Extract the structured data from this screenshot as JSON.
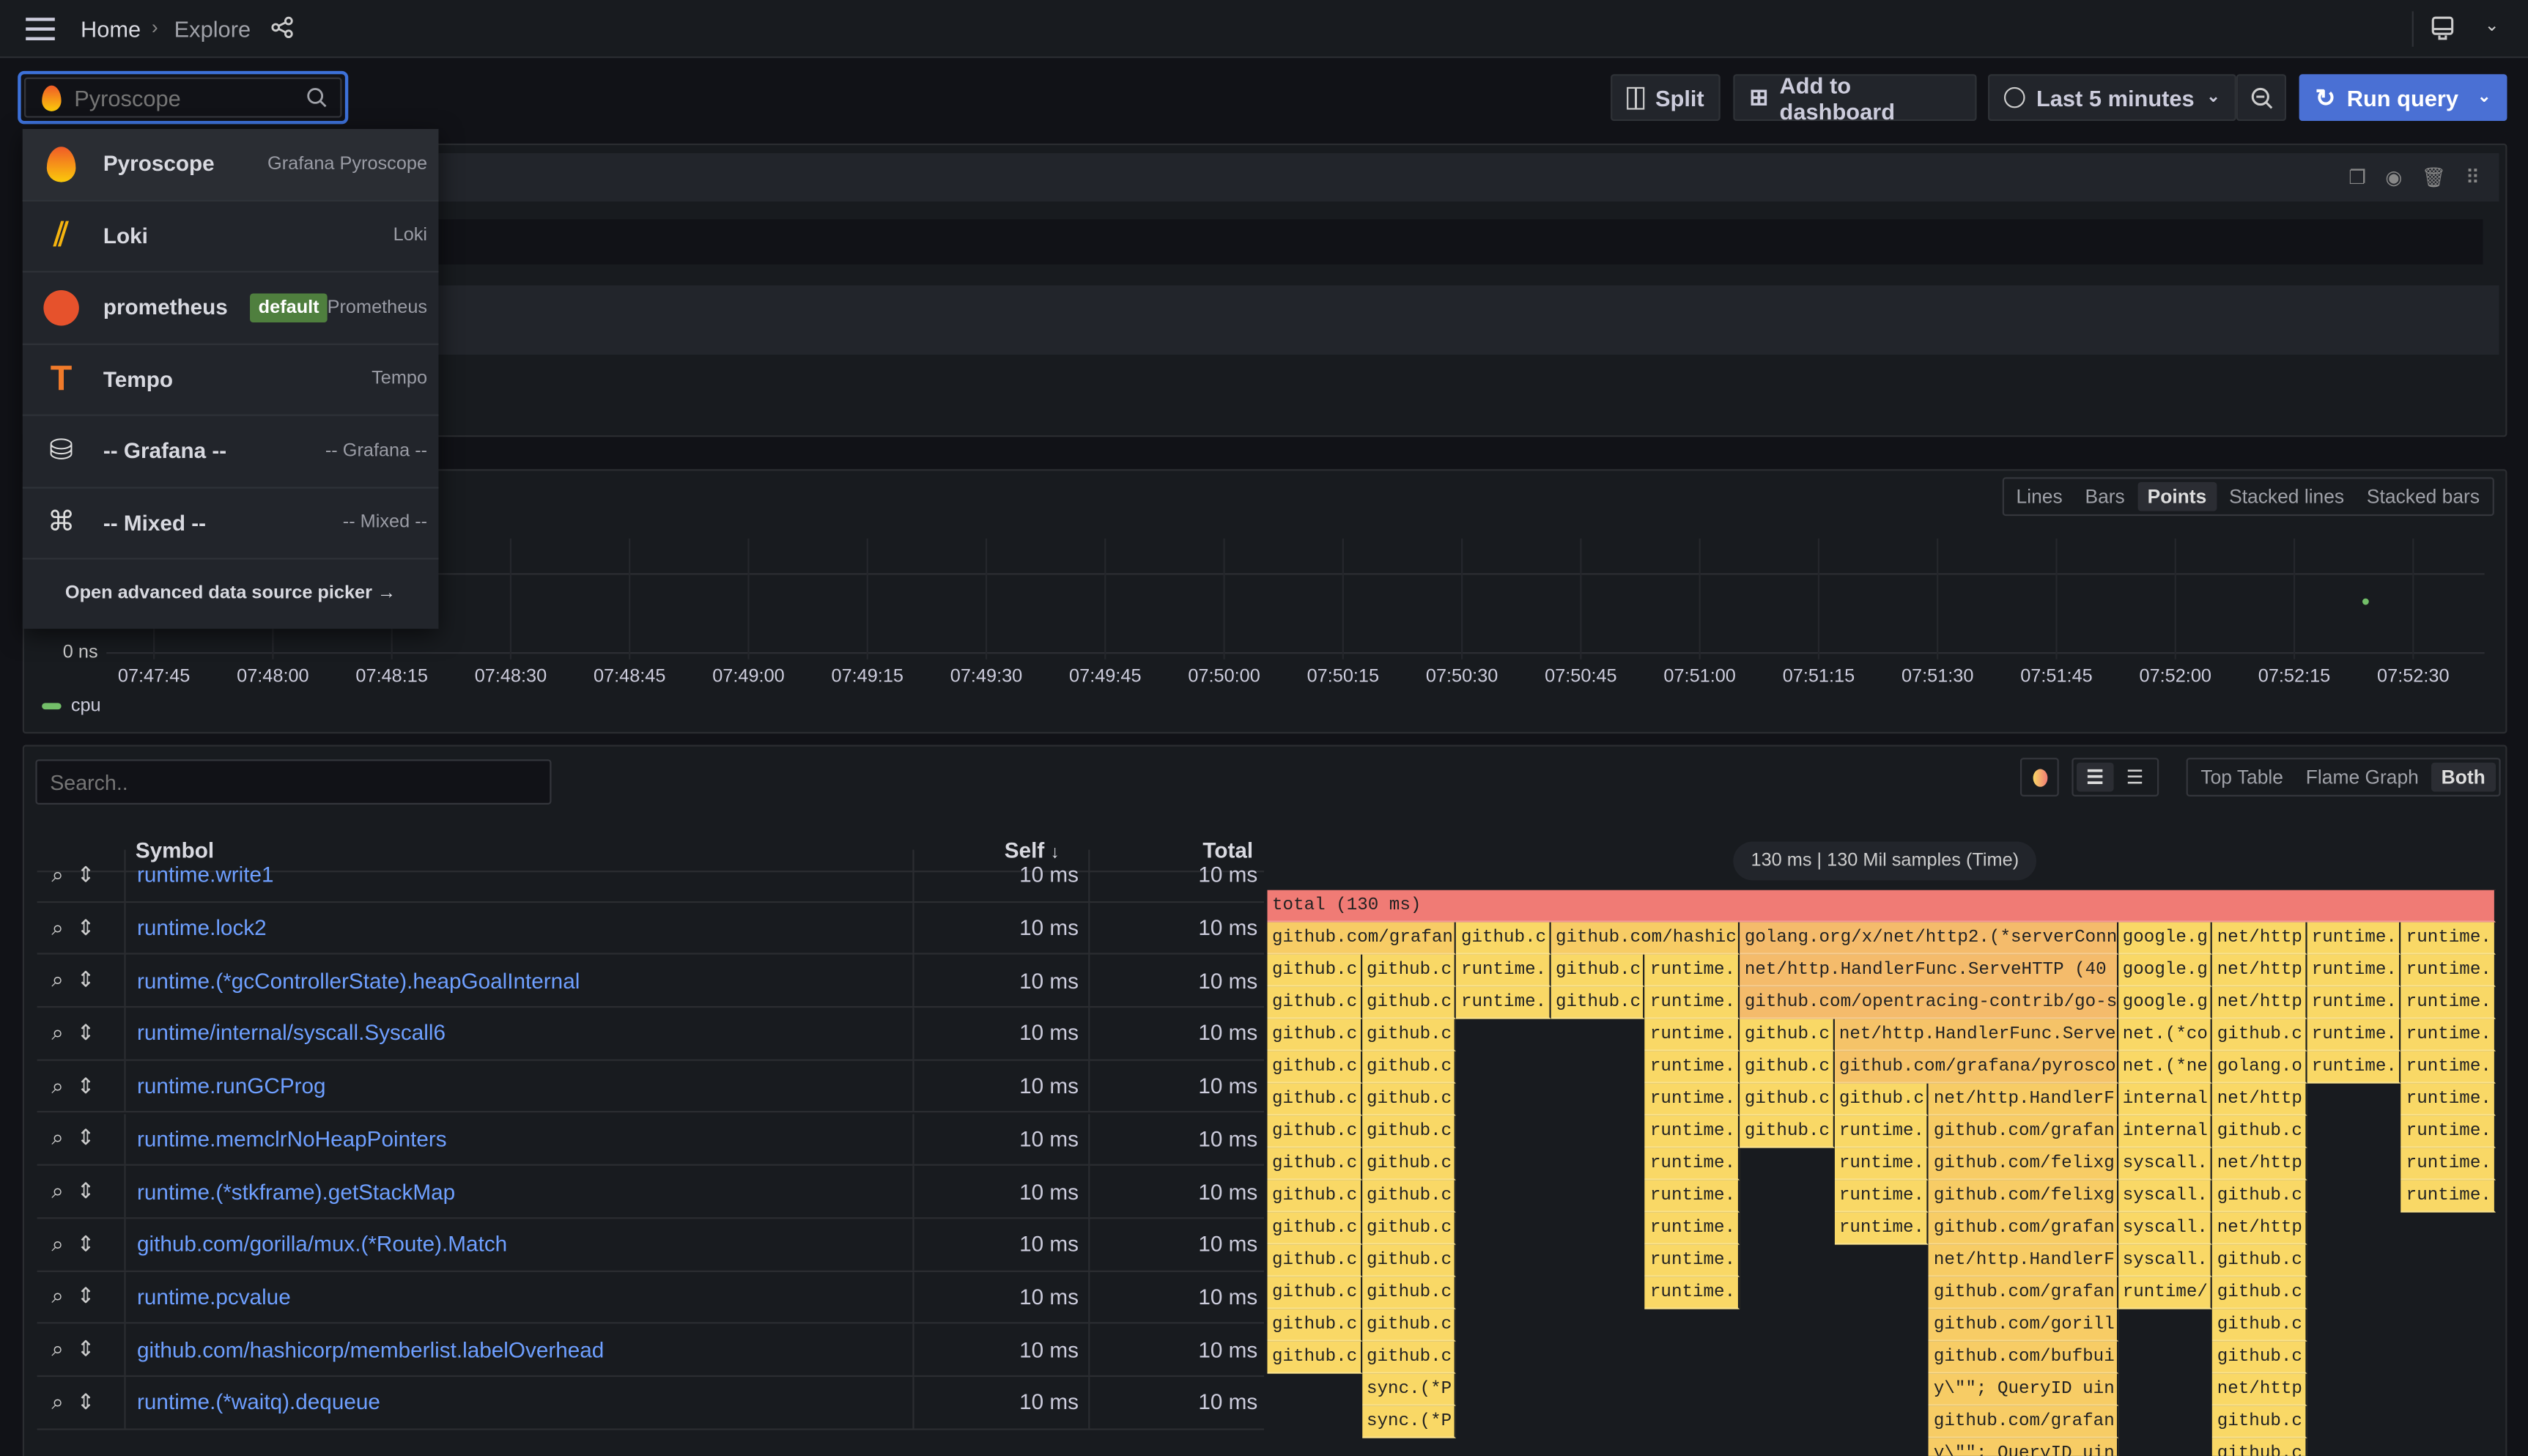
{
  "topbar": {
    "breadcrumb": [
      "Home",
      "Explore"
    ]
  },
  "toolbar": {
    "datasource_input": "Pyroscope",
    "split": "Split",
    "add_to_dashboard": "Add to dashboard",
    "time_range": "Last 5 minutes",
    "run_query": "Run query",
    "accent": "#3d71d9"
  },
  "datasource_dropdown": {
    "items": [
      {
        "name": "Pyroscope",
        "type": "Grafana Pyroscope",
        "icon": "pyroscope-icon"
      },
      {
        "name": "Loki",
        "type": "Loki",
        "icon": "loki-icon"
      },
      {
        "name": "prometheus",
        "type": "Prometheus",
        "badge": "default",
        "icon": "prometheus-icon"
      },
      {
        "name": "Tempo",
        "type": "Tempo",
        "icon": "tempo-icon"
      },
      {
        "name": "-- Grafana --",
        "type": "-- Grafana --",
        "icon": "grafana-db-icon"
      },
      {
        "name": "-- Mixed --",
        "type": "-- Mixed --",
        "icon": "mixed-icon"
      }
    ],
    "advanced_link": "Open advanced data source picker →"
  },
  "graph": {
    "modes": [
      "Lines",
      "Bars",
      "Points",
      "Stacked lines",
      "Stacked bars"
    ],
    "active_mode": "Points"
  },
  "chart_data": {
    "type": "scatter",
    "x_ticks": [
      "07:47:45",
      "07:48:00",
      "07:48:15",
      "07:48:30",
      "07:48:45",
      "07:49:00",
      "07:49:15",
      "07:49:30",
      "07:49:45",
      "07:50:00",
      "07:50:15",
      "07:50:30",
      "07:50:45",
      "07:51:00",
      "07:51:15",
      "07:51:30",
      "07:51:45",
      "07:52:00",
      "07:52:15",
      "07:52:30"
    ],
    "xlim": [
      "07:47:39",
      "07:52:39"
    ],
    "y_tick_labels": [
      "0 ns"
    ],
    "series": [
      {
        "name": "cpu",
        "color": "#73bf69",
        "points": [
          {
            "x": "07:52:24",
            "y_ms": 130
          }
        ]
      }
    ],
    "ylim_ms": [
      0,
      200
    ],
    "grid": true,
    "legend": "bottom-left"
  },
  "flame": {
    "search_placeholder": "Search..",
    "views": [
      "Top Table",
      "Flame Graph",
      "Both"
    ],
    "active_view": "Both",
    "table": {
      "headers": [
        "Symbol",
        "Self",
        "Total"
      ],
      "sort_indicator": "↓",
      "rows": [
        [
          "runtime.write1",
          "10 ms",
          "10 ms"
        ],
        [
          "runtime.lock2",
          "10 ms",
          "10 ms"
        ],
        [
          "runtime.(*gcControllerState).heapGoalInternal",
          "10 ms",
          "10 ms"
        ],
        [
          "runtime/internal/syscall.Syscall6",
          "10 ms",
          "10 ms"
        ],
        [
          "runtime.runGCProg",
          "10 ms",
          "10 ms"
        ],
        [
          "runtime.memclrNoHeapPointers",
          "10 ms",
          "10 ms"
        ],
        [
          "runtime.(*stkframe).getStackMap",
          "10 ms",
          "10 ms"
        ],
        [
          "github.com/gorilla/mux.(*Route).Match",
          "10 ms",
          "10 ms"
        ],
        [
          "runtime.pcvalue",
          "10 ms",
          "10 ms"
        ],
        [
          "github.com/hashicorp/memberlist.labelOverhead",
          "10 ms",
          "10 ms"
        ],
        [
          "runtime.(*waitq).dequeue",
          "10 ms",
          "10 ms"
        ]
      ]
    },
    "summary": "130 ms | 130 Mil samples (Time)",
    "total_ms": 130,
    "frames": [
      [
        0,
        0,
        130,
        "total (130 ms)"
      ],
      [
        1,
        0,
        20,
        "github.com/grafan"
      ],
      [
        1,
        20,
        10,
        "github.c"
      ],
      [
        1,
        30,
        20,
        "github.com/hashic"
      ],
      [
        1,
        50,
        40,
        "golang.org/x/net/http2.(*serverConn"
      ],
      [
        1,
        90,
        10,
        "google.g"
      ],
      [
        1,
        100,
        10,
        "net/http"
      ],
      [
        1,
        110,
        10,
        "runtime."
      ],
      [
        1,
        120,
        10,
        "runtime."
      ],
      [
        2,
        0,
        10,
        "github.c"
      ],
      [
        2,
        10,
        10,
        "github.c"
      ],
      [
        2,
        20,
        10,
        "runtime."
      ],
      [
        2,
        30,
        10,
        "github.c"
      ],
      [
        2,
        40,
        10,
        "runtime."
      ],
      [
        2,
        50,
        40,
        "net/http.HandlerFunc.ServeHTTP (40"
      ],
      [
        2,
        90,
        10,
        "google.g"
      ],
      [
        2,
        100,
        10,
        "net/http"
      ],
      [
        2,
        110,
        10,
        "runtime."
      ],
      [
        2,
        120,
        10,
        "runtime."
      ],
      [
        3,
        0,
        10,
        "github.c"
      ],
      [
        3,
        10,
        10,
        "github.c"
      ],
      [
        3,
        20,
        10,
        "runtime."
      ],
      [
        3,
        30,
        10,
        "github.c"
      ],
      [
        3,
        40,
        10,
        "runtime."
      ],
      [
        3,
        50,
        40,
        "github.com/opentracing-contrib/go-s"
      ],
      [
        3,
        90,
        10,
        "google.g"
      ],
      [
        3,
        100,
        10,
        "net/http"
      ],
      [
        3,
        110,
        10,
        "runtime."
      ],
      [
        3,
        120,
        10,
        "runtime."
      ],
      [
        4,
        0,
        10,
        "github.c"
      ],
      [
        4,
        10,
        10,
        "github.c"
      ],
      [
        4,
        40,
        10,
        "runtime."
      ],
      [
        4,
        50,
        10,
        "github.c"
      ],
      [
        4,
        60,
        30,
        "net/http.HandlerFunc.Serve"
      ],
      [
        4,
        90,
        10,
        "net.(*co"
      ],
      [
        4,
        100,
        10,
        "github.c"
      ],
      [
        4,
        110,
        10,
        "runtime."
      ],
      [
        4,
        120,
        10,
        "runtime."
      ],
      [
        5,
        0,
        10,
        "github.c"
      ],
      [
        5,
        10,
        10,
        "github.c"
      ],
      [
        5,
        40,
        10,
        "runtime."
      ],
      [
        5,
        50,
        10,
        "github.c"
      ],
      [
        5,
        60,
        30,
        "github.com/grafana/pyrosco"
      ],
      [
        5,
        90,
        10,
        "net.(*ne"
      ],
      [
        5,
        100,
        10,
        "golang.o"
      ],
      [
        5,
        110,
        10,
        "runtime."
      ],
      [
        5,
        120,
        10,
        "runtime."
      ],
      [
        6,
        0,
        10,
        "github.c"
      ],
      [
        6,
        10,
        10,
        "github.c"
      ],
      [
        6,
        40,
        10,
        "runtime."
      ],
      [
        6,
        50,
        10,
        "github.c"
      ],
      [
        6,
        60,
        10,
        "github.c"
      ],
      [
        6,
        70,
        20,
        "net/http.HandlerF"
      ],
      [
        6,
        90,
        10,
        "internal"
      ],
      [
        6,
        100,
        10,
        "net/http"
      ],
      [
        6,
        120,
        10,
        "runtime."
      ],
      [
        7,
        0,
        10,
        "github.c"
      ],
      [
        7,
        10,
        10,
        "github.c"
      ],
      [
        7,
        40,
        10,
        "runtime."
      ],
      [
        7,
        50,
        10,
        "github.c"
      ],
      [
        7,
        60,
        10,
        "runtime."
      ],
      [
        7,
        70,
        20,
        "github.com/grafan"
      ],
      [
        7,
        90,
        10,
        "internal"
      ],
      [
        7,
        100,
        10,
        "github.c"
      ],
      [
        7,
        120,
        10,
        "runtime."
      ],
      [
        8,
        0,
        10,
        "github.c"
      ],
      [
        8,
        10,
        10,
        "github.c"
      ],
      [
        8,
        40,
        10,
        "runtime."
      ],
      [
        8,
        60,
        10,
        "runtime."
      ],
      [
        8,
        70,
        20,
        "github.com/felixg"
      ],
      [
        8,
        90,
        10,
        "syscall."
      ],
      [
        8,
        100,
        10,
        "net/http"
      ],
      [
        8,
        120,
        10,
        "runtime."
      ],
      [
        9,
        0,
        10,
        "github.c"
      ],
      [
        9,
        10,
        10,
        "github.c"
      ],
      [
        9,
        40,
        10,
        "runtime."
      ],
      [
        9,
        60,
        10,
        "runtime."
      ],
      [
        9,
        70,
        20,
        "github.com/felixg"
      ],
      [
        9,
        90,
        10,
        "syscall."
      ],
      [
        9,
        100,
        10,
        "github.c"
      ],
      [
        9,
        120,
        10,
        "runtime."
      ],
      [
        10,
        0,
        10,
        "github.c"
      ],
      [
        10,
        10,
        10,
        "github.c"
      ],
      [
        10,
        40,
        10,
        "runtime."
      ],
      [
        10,
        60,
        10,
        "runtime."
      ],
      [
        10,
        70,
        20,
        "github.com/grafan"
      ],
      [
        10,
        90,
        10,
        "syscall."
      ],
      [
        10,
        100,
        10,
        "net/http"
      ],
      [
        11,
        0,
        10,
        "github.c"
      ],
      [
        11,
        10,
        10,
        "github.c"
      ],
      [
        11,
        40,
        10,
        "runtime."
      ],
      [
        11,
        70,
        20,
        "net/http.HandlerF"
      ],
      [
        11,
        90,
        10,
        "syscall."
      ],
      [
        11,
        100,
        10,
        "github.c"
      ],
      [
        12,
        0,
        10,
        "github.c"
      ],
      [
        12,
        10,
        10,
        "github.c"
      ],
      [
        12,
        40,
        10,
        "runtime."
      ],
      [
        12,
        70,
        20,
        "github.com/grafan"
      ],
      [
        12,
        90,
        10,
        "runtime/"
      ],
      [
        12,
        100,
        10,
        "github.c"
      ],
      [
        13,
        0,
        10,
        "github.c"
      ],
      [
        13,
        10,
        10,
        "github.c"
      ],
      [
        13,
        70,
        20,
        "github.com/gorill"
      ],
      [
        13,
        100,
        10,
        "github.c"
      ],
      [
        14,
        0,
        10,
        "github.c"
      ],
      [
        14,
        10,
        10,
        "github.c"
      ],
      [
        14,
        70,
        20,
        "github.com/bufbui"
      ],
      [
        14,
        100,
        10,
        "github.c"
      ],
      [
        15,
        10,
        10,
        "sync.(*P"
      ],
      [
        15,
        70,
        20,
        "y\\\"\"; QueryID uin"
      ],
      [
        15,
        100,
        10,
        "net/http"
      ],
      [
        16,
        10,
        10,
        "sync.(*P"
      ],
      [
        16,
        70,
        20,
        "github.com/grafan"
      ],
      [
        16,
        100,
        10,
        "github.c"
      ],
      [
        17,
        70,
        20,
        "y\\\"\"; QueryID uin"
      ],
      [
        17,
        100,
        10,
        "github.c"
      ]
    ]
  }
}
